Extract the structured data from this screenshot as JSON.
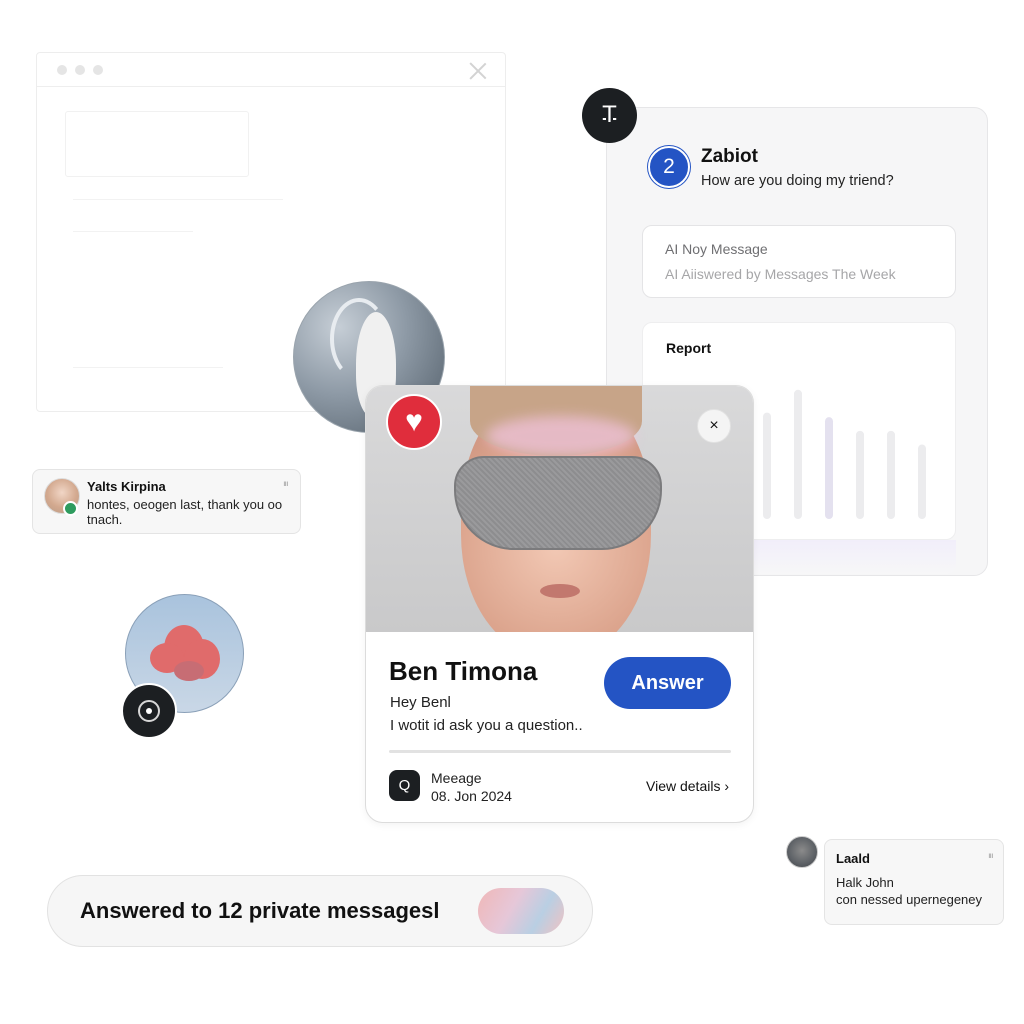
{
  "chat_panel": {
    "badge_count": "2",
    "bot_name": "Zabiot",
    "bot_message": "How are you doing my triend?",
    "ai_card": {
      "title": "AI Noy Message",
      "subtitle": "AI Aiiswered by Messages The Week"
    },
    "report": {
      "title": "Report",
      "bars": [
        {
          "value": 0.7,
          "color": "#ececee"
        },
        {
          "value": 0.85,
          "color": "#ececee"
        },
        {
          "value": 0.67,
          "color": "#e4e1ef"
        },
        {
          "value": 0.58,
          "color": "#ececee"
        },
        {
          "value": 0.58,
          "color": "#ececee"
        },
        {
          "value": 0.49,
          "color": "#ececee"
        }
      ]
    }
  },
  "left_bubble": {
    "name": "Yalts Kirpina",
    "time": "ᴵᴵᴵ",
    "message": "hontes, oeogen last, thank you oo tnach."
  },
  "main_card": {
    "sender_name": "Ben Timona",
    "greeting": "Hey Benl",
    "preview": "I wotit id ask you a question..",
    "answer_label": "Answer",
    "close_label": "×",
    "heart_label": "♥",
    "meta_label": "Meeage",
    "meta_date": "08. Jon 2024",
    "view_details": "View details ›",
    "msg_icon": "Q"
  },
  "right_bubble": {
    "name": "Laald",
    "time": "ᴵᴵᴵ",
    "line1": "Halk John",
    "line2": "con nessed upernegeney"
  },
  "answered_pill": {
    "text": "Answered to 12 private messagesl"
  },
  "text_tool_label": "T",
  "colors": {
    "accent": "#2454c4",
    "heart": "#e02d3c",
    "dark": "#1c1f22",
    "online": "#2e9b5e"
  },
  "icons": {
    "text_tool": "text-cursor-icon",
    "heart": "heart-icon",
    "close": "close-icon",
    "camera": "camera-icon",
    "message": "message-search-icon",
    "chevron": "chevron-right-icon"
  }
}
